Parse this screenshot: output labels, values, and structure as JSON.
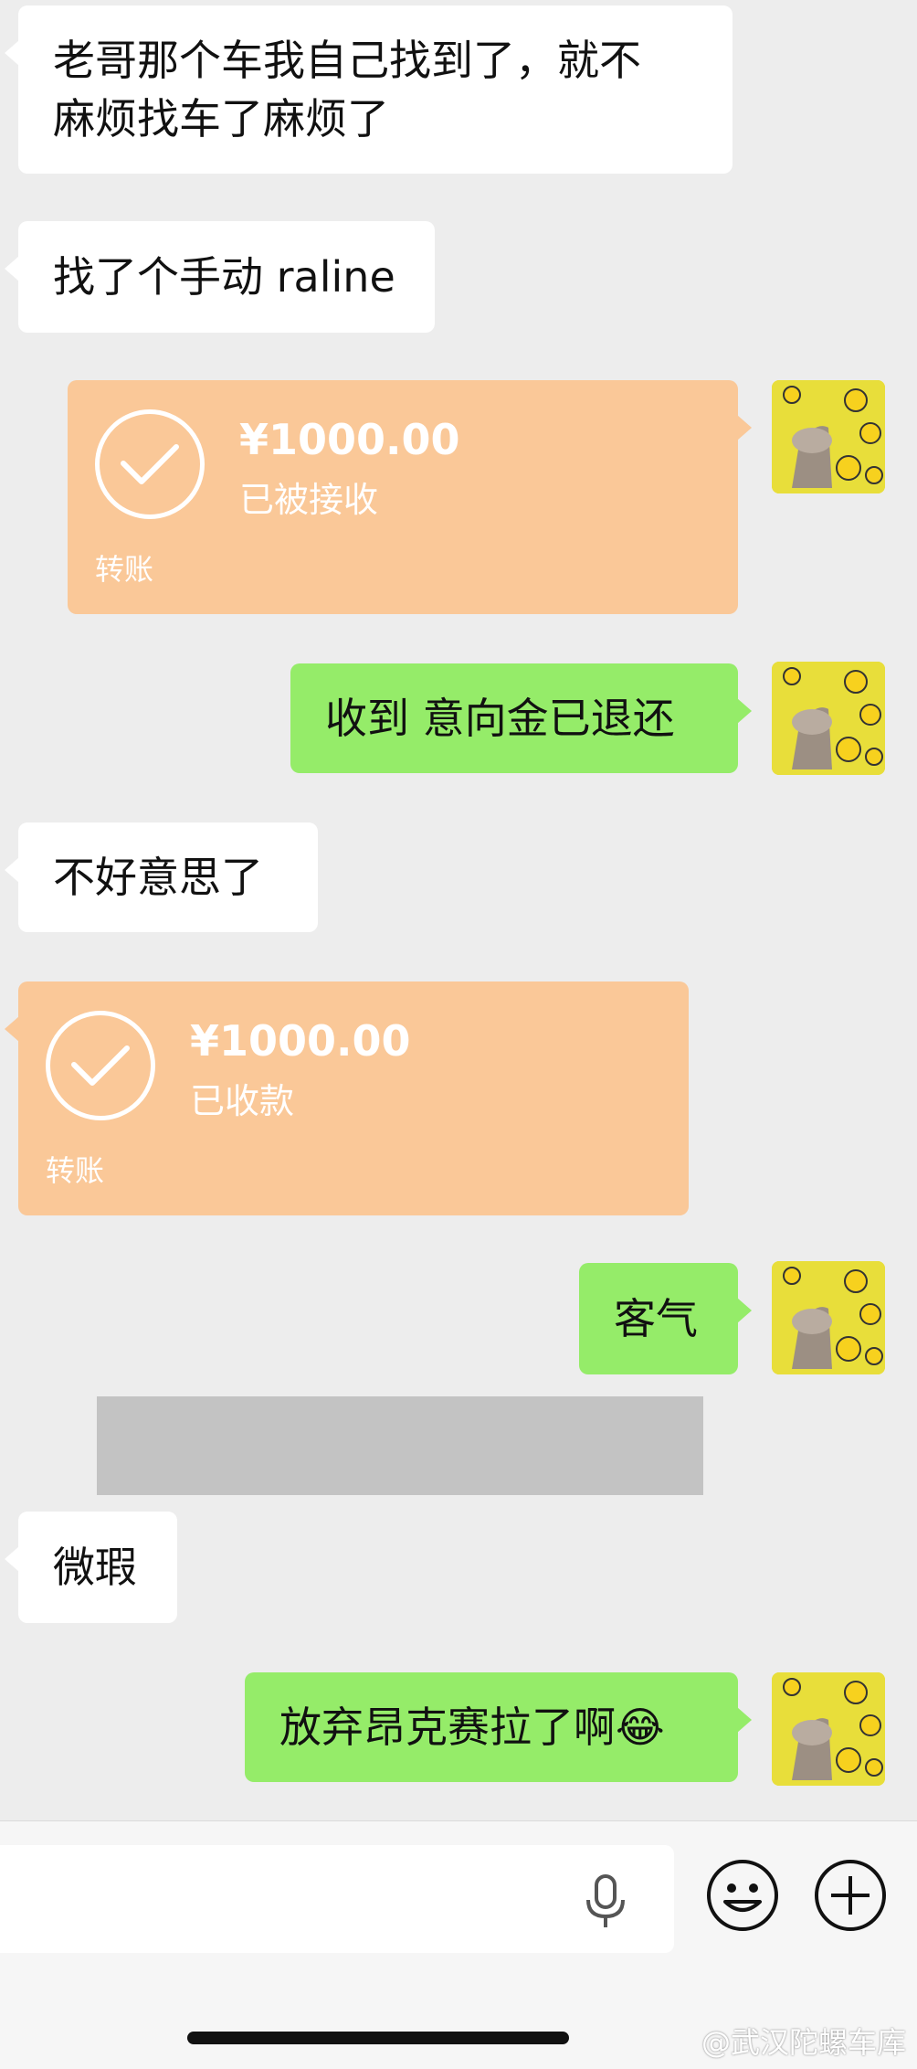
{
  "messages": {
    "m1_line1": "老哥那个车我自己找到了，就不",
    "m1_line2": "麻烦找车了麻烦了",
    "m2": "找了个手动 raline",
    "t1_amount": "¥1000.00",
    "t1_status": "已被接收",
    "t1_label": "转账",
    "m3": "收到 意向金已退还",
    "m4": "不好意思了",
    "t2_amount": "¥1000.00",
    "t2_status": "已收款",
    "t2_label": "转账",
    "m5": "客气",
    "m6": "微瑕",
    "m7": "放弃昂克赛拉了啊😂"
  },
  "icons": {
    "voice": "microphone-icon",
    "emoji": "emoji-icon",
    "more": "plus-icon"
  },
  "watermark": "@武汉陀螺车库",
  "colors": {
    "background": "#ededed",
    "incoming": "#ffffff",
    "outgoing": "#95ec69",
    "transfer": "#fac898"
  }
}
